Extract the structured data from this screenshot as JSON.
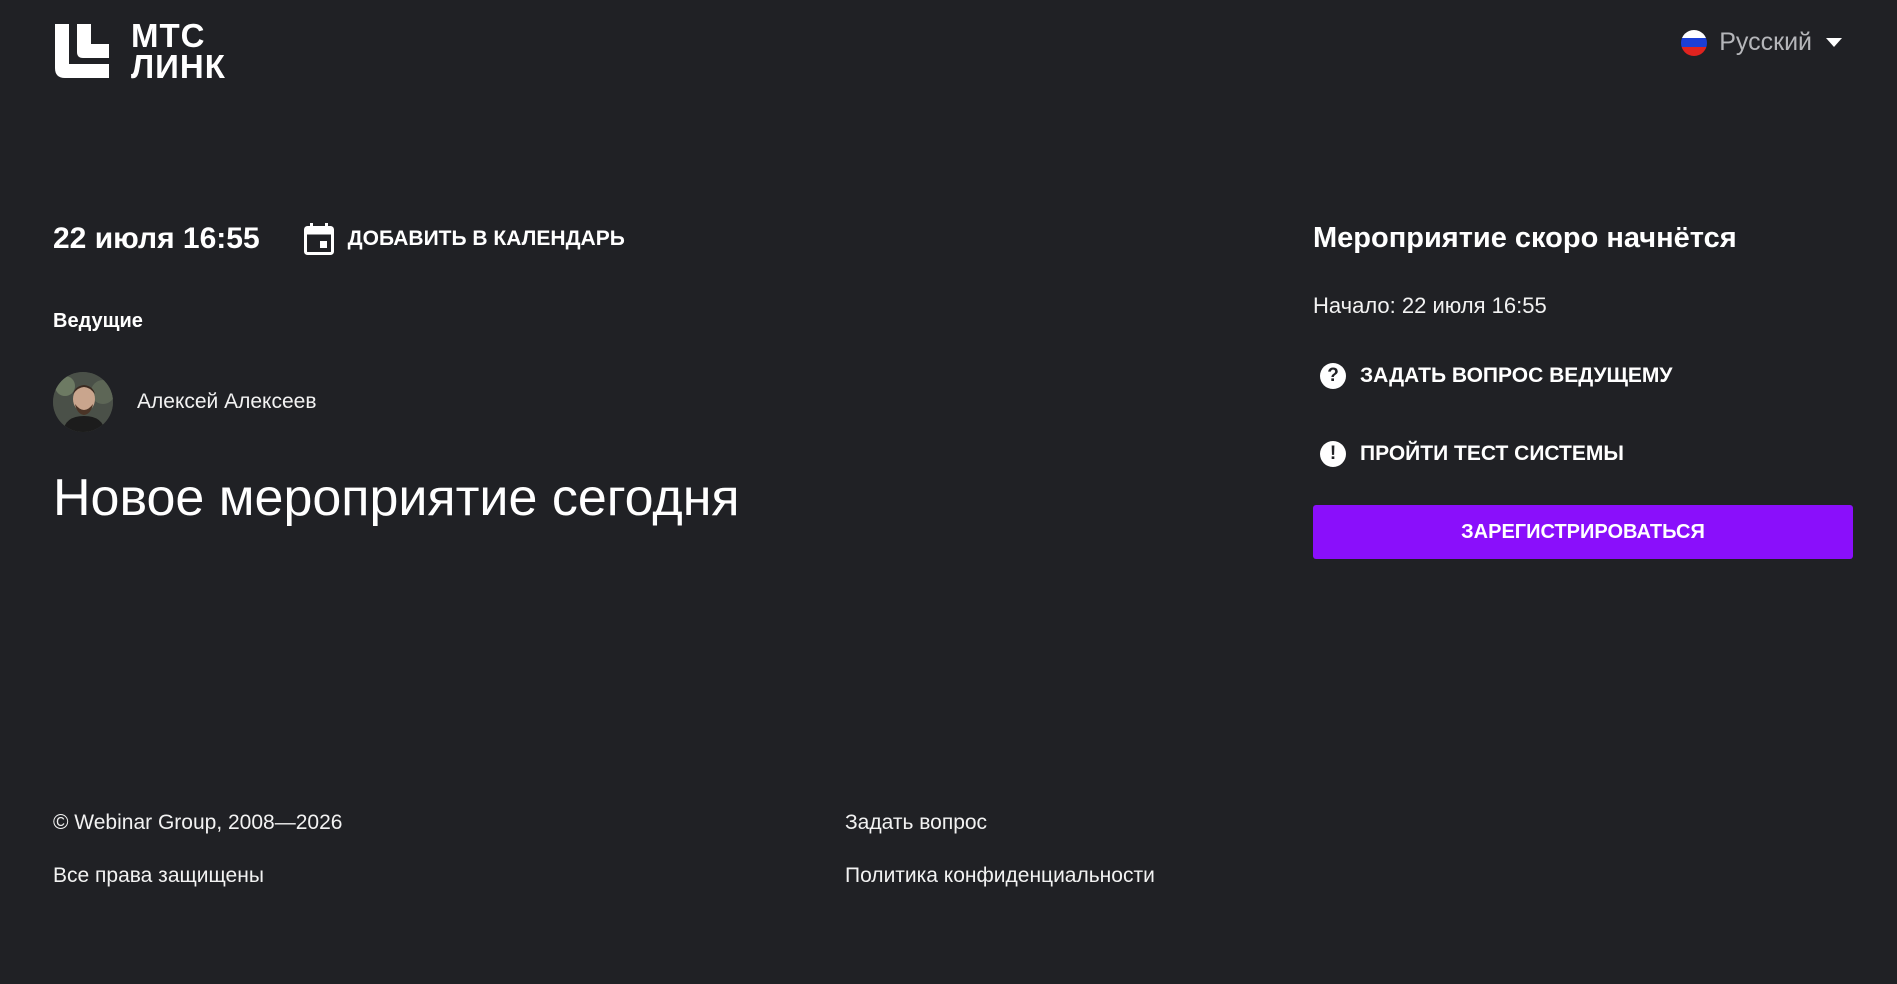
{
  "brand": {
    "logo_line1": "МТС",
    "logo_line2": "ЛИНК"
  },
  "language": {
    "selected": "Русский",
    "icon": "russian-flag-icon"
  },
  "event": {
    "date": "22 июля 16:55",
    "add_to_calendar": "ДОБАВИТЬ В КАЛЕНДАРЬ",
    "hosts_label": "Ведущие",
    "hosts": [
      {
        "name": "Алексей Алексеев"
      }
    ],
    "title": "Новое мероприятие сегодня"
  },
  "status": {
    "title": "Мероприятие скоро начнётся",
    "start": "Начало: 22 июля 16:55",
    "ask_host": "ЗАДАТЬ ВОПРОС ВЕДУЩЕМУ",
    "system_test": "ПРОЙТИ ТЕСТ СИСТЕМЫ",
    "register": "ЗАРЕГИСТРИРОВАТЬСЯ"
  },
  "footer": {
    "copyright": "© Webinar Group, 2008—2026",
    "rights": "Все права защищены",
    "ask_link": "Задать вопрос",
    "privacy_link": "Политика конфиденциальности"
  },
  "colors": {
    "background": "#202125",
    "accent": "#8a0ffb",
    "text": "#ffffff",
    "muted": "#b5b6ba"
  }
}
